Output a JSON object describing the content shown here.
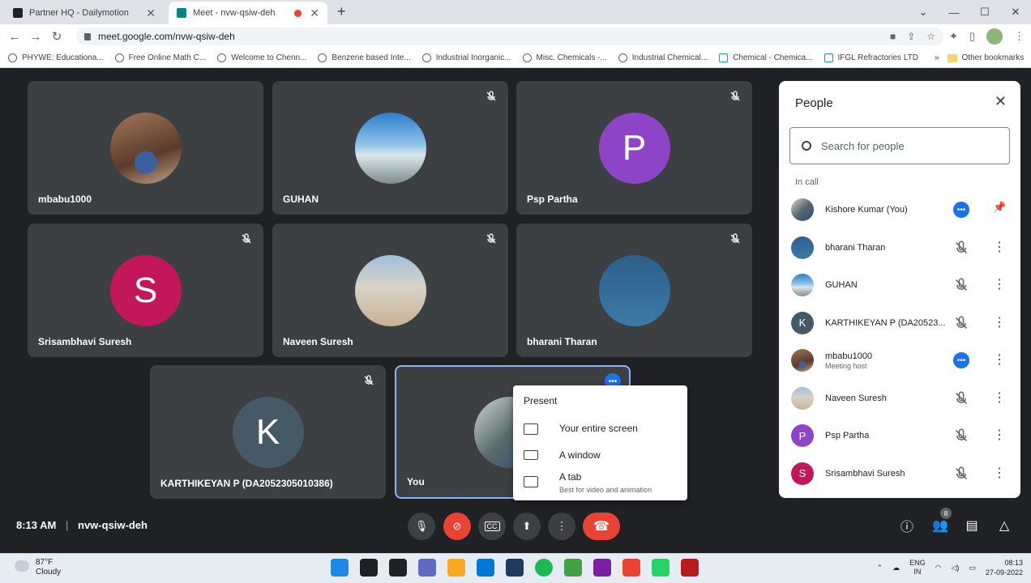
{
  "browser": {
    "tabs": [
      {
        "label": "Partner HQ - Dailymotion",
        "fav_color": "#202124"
      },
      {
        "label": "Meet - nvw-qsiw-deh",
        "fav_color": "#00897b"
      }
    ],
    "url": "meet.google.com/nvw-qsiw-deh",
    "bookmarks": [
      "PHYWE: Educationa...",
      "Free Online Math C...",
      "Welcome to Chenn...",
      "Benzene based Inte...",
      "Industrial Inorganic...",
      "Misc. Chemicals -...",
      "Industrial Chemical...",
      "Chemical - Chemica...",
      "IFGL Refractories LTD"
    ],
    "other_bookmarks": "Other bookmarks",
    "more_bookmarks": "»"
  },
  "tiles": [
    {
      "name": "mbabu1000",
      "type": "photo1",
      "muted": false
    },
    {
      "name": "GUHAN",
      "type": "photo2",
      "muted": true
    },
    {
      "name": "Psp Partha",
      "letter": "P",
      "color": "#8e44c6",
      "muted": true
    },
    {
      "name": "Srisambhavi Suresh",
      "letter": "S",
      "color": "#c2185b",
      "muted": true
    },
    {
      "name": "Naveen Suresh",
      "type": "photo3",
      "muted": true
    },
    {
      "name": "bharani Tharan",
      "type": "photo4",
      "muted": true
    },
    {
      "name": "KARTHIKEYAN P (DA2052305010386)",
      "letter": "K",
      "color": "#455a64",
      "muted": true
    },
    {
      "name": "You",
      "type": "photo5",
      "muted": false
    }
  ],
  "present_menu": {
    "title": "Present",
    "items": [
      {
        "label": "Your entire screen",
        "sub": ""
      },
      {
        "label": "A window",
        "sub": ""
      },
      {
        "label": "A tab",
        "sub": "Best for video and animation"
      }
    ]
  },
  "meeting": {
    "time": "8:13 AM",
    "separator": "|",
    "code": "nvw-qsiw-deh",
    "people_count": "8"
  },
  "people_panel": {
    "title": "People",
    "search_placeholder": "Search for people",
    "section": "In call",
    "people": [
      {
        "name": "Kishore Kumar (You)",
        "sub": "",
        "avatar": "photo5",
        "status": "dots"
      },
      {
        "name": "bharani Tharan",
        "sub": "",
        "avatar": "photo4",
        "status": "muted"
      },
      {
        "name": "GUHAN",
        "sub": "",
        "avatar": "photo2",
        "status": "muted"
      },
      {
        "name": "KARTHIKEYAN P (DA20523...",
        "sub": "",
        "letter": "K",
        "color": "#455a64",
        "status": "muted"
      },
      {
        "name": "mbabu1000",
        "sub": "Meeting host",
        "avatar": "photo1",
        "status": "dots"
      },
      {
        "name": "Naveen Suresh",
        "sub": "",
        "avatar": "photo3",
        "status": "muted"
      },
      {
        "name": "Psp Partha",
        "sub": "",
        "letter": "P",
        "color": "#8e44c6",
        "status": "muted"
      },
      {
        "name": "Srisambhavi Suresh",
        "sub": "",
        "letter": "S",
        "color": "#c2185b",
        "status": "muted"
      }
    ]
  },
  "taskbar": {
    "temp": "87°F",
    "weather": "Cloudy",
    "lang1": "ENG",
    "lang2": "IN",
    "time": "08:13",
    "date": "27-09-2022",
    "app_colors": [
      "#1e88e5",
      "#202124",
      "#202124",
      "#5c6bc0",
      "#f9a825",
      "#0078d4",
      "#1e3a5f",
      "#1db954",
      "#43a047",
      "#7b1fa2",
      "#ea4335",
      "#25d366",
      "#b71c1c"
    ]
  }
}
